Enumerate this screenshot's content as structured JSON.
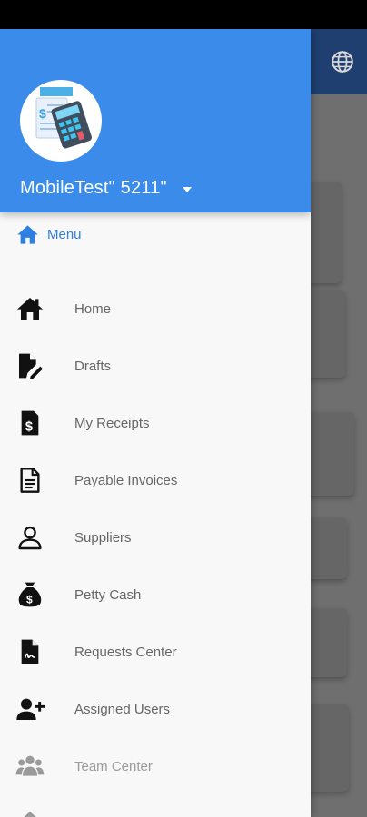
{
  "drawer": {
    "account_name": "MobileTest\" 5211\"",
    "menu_label": "Menu",
    "items": [
      {
        "label": "Home",
        "icon": "home-icon"
      },
      {
        "label": "Drafts",
        "icon": "draft-edit-icon"
      },
      {
        "label": "My Receipts",
        "icon": "receipt-dollar-icon"
      },
      {
        "label": "Payable Invoices",
        "icon": "invoice-document-icon"
      },
      {
        "label": "Suppliers",
        "icon": "person-outline-icon"
      },
      {
        "label": "Petty Cash",
        "icon": "money-bag-icon"
      },
      {
        "label": "Requests Center",
        "icon": "signed-document-icon"
      },
      {
        "label": "Assigned Users",
        "icon": "add-user-icon"
      },
      {
        "label": "Team Center",
        "icon": "group-icon"
      }
    ]
  },
  "colors": {
    "header": "#3b8beb",
    "accent": "#2f7fe0",
    "appbar_dimmed": "#1e3f70"
  },
  "background": {
    "appbar_icon": "globe-icon"
  }
}
